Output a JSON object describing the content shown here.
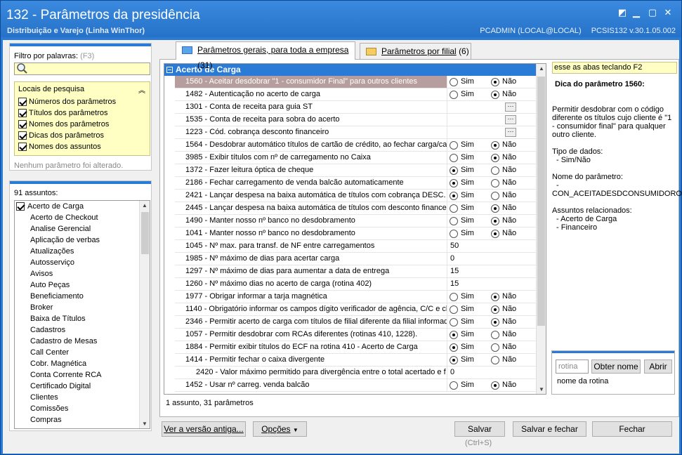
{
  "window": {
    "title": "132 - Parâmetros da presidência",
    "subtitle": "Distribuição e Varejo (Linha WinThor)",
    "user": "PCADMIN (LOCAL@LOCAL)",
    "version": "PCSIS132  v.30.1.05.002"
  },
  "filter": {
    "label": "Filtro por palavras:",
    "shortcut": "(F3)",
    "value": "",
    "locais_title": "Locais de pesquisa",
    "options": [
      "Números dos parâmetros",
      "Títulos dos parâmetros",
      "Nomes dos parâmetros",
      "Dicas dos parâmetros",
      "Nomes dos assuntos"
    ],
    "status": "Nenhum parâmetro foi alterado."
  },
  "subjects": {
    "count_label": "91 assuntos:",
    "items": [
      "Acerto de Carga",
      "Acerto de Checkout",
      "Analise Gerencial",
      "Aplicação de verbas",
      "Atualizações",
      "Autosserviço",
      "Avisos",
      "Auto Peças",
      "Beneficiamento",
      "Broker",
      "Baixa de Títulos",
      "Cadastros",
      "Cadastro de Mesas",
      "Call Center",
      "Cobr. Magnética",
      "Conta Corrente RCA",
      "Certificado Digital",
      "Clientes",
      "Comissões",
      "Compras"
    ]
  },
  "tabs": [
    {
      "label": "Parâmetros gerais, para toda a empresa",
      "count": "(31)"
    },
    {
      "label": "Parâmetros por filial",
      "count": "(6)"
    }
  ],
  "grid": {
    "group": "Acerto de Carga",
    "sim": "Sim",
    "nao": "Não",
    "rows": [
      {
        "name": "1560 - Aceitar desdobrar \"1 - consumidor Final\" para outros clientes",
        "type": "radio",
        "value": "Não"
      },
      {
        "name": "1482 - Autenticação no acerto de carga",
        "type": "radio",
        "value": "Não"
      },
      {
        "name": "1301 - Conta de receita para guia ST",
        "type": "lookup",
        "value": ""
      },
      {
        "name": "1535 - Conta de receita para sobra do acerto",
        "type": "lookup",
        "value": ""
      },
      {
        "name": "1223 - Cód. cobrança desconto financeiro",
        "type": "lookup",
        "value": ""
      },
      {
        "name": "1564 - Desdobrar automático títulos de cartão de crédito, ao fechar carga/ca",
        "type": "radio",
        "value": "Não"
      },
      {
        "name": "3985 - Exibir títulos com nº de carregamento no Caixa",
        "type": "radio",
        "value": "Não"
      },
      {
        "name": "1372 - Fazer leitura óptica de cheque",
        "type": "radio",
        "value": "Sim"
      },
      {
        "name": "2186 - Fechar carregamento de venda balcão automaticamente",
        "type": "radio",
        "value": "Sim"
      },
      {
        "name": "2421 - Lançar despesa na baixa automática de títulos com cobrança DESC.",
        "type": "radio",
        "value": "Sim"
      },
      {
        "name": "2445 - Lançar despesa na baixa automática de títulos com desconto financeir",
        "type": "radio",
        "value": "Não"
      },
      {
        "name": "1490 - Manter nosso nº banco no desdobramento",
        "type": "radio",
        "value": "Não"
      },
      {
        "name": "1041 - Manter nosso nº banco no desdobramento",
        "type": "radio",
        "value": "Não"
      },
      {
        "name": "1045 - Nº max. para transf. de NF entre carregamentos",
        "type": "number",
        "value": "50"
      },
      {
        "name": "1985 - Nº máximo de dias para acertar carga",
        "type": "number",
        "value": "0"
      },
      {
        "name": "1297 - Nº máximo de dias para aumentar a data de entrega",
        "type": "number",
        "value": "15"
      },
      {
        "name": "1260 - Nº máximo dias no acerto de carga (rotina 402)",
        "type": "number",
        "value": "15"
      },
      {
        "name": "1977 - Obrigar informar a tarja magnética",
        "type": "radio",
        "value": "Não"
      },
      {
        "name": "1140 - Obrigatório informar os campos dígito verificador de agência, C/C e ch",
        "type": "radio",
        "value": "Não"
      },
      {
        "name": "2346 - Permitir acerto de carga com títulos de filial diferente da filial informad",
        "type": "radio",
        "value": "Não"
      },
      {
        "name": "1057 - Permitir desdobrar com RCAs diferentes (rotinas 410, 1228).",
        "type": "radio",
        "value": "Sim"
      },
      {
        "name": "1884 - Permitir exibir títulos do ECF na rotina 410 - Acerto de Carga",
        "type": "radio",
        "value": "Sim"
      },
      {
        "name": "1414 - Permitir fechar o caixa divergente",
        "type": "radio",
        "value": "Sim"
      },
      {
        "name": "2420 - Valor máximo permitido para divergência entre o total acertado e f",
        "type": "number",
        "value": "0",
        "indent": true
      },
      {
        "name": "1452 - Usar nº carreg. venda balcão",
        "type": "radio",
        "value": "Não"
      }
    ],
    "status": "1 assunto, 31 parâmetros"
  },
  "tip": {
    "hint": "esse as abas teclando F2",
    "title": "Dica do parâmetro 1560:",
    "description": "Permitir desdobrar com o código diferente os títulos cujo cliente é \"1 - consumidor final\" para qualquer outro cliente.",
    "data_type_label": "Tipo de dados:",
    "data_type": "- Sim/Não",
    "param_name_label": "Nome do parâmetro:",
    "param_name_dash": "-",
    "param_name": "CON_ACEITADESDCONSUMIDORO",
    "related_label": "Assuntos relacionados:",
    "related": [
      "- Acerto de Carga",
      "- Financeiro"
    ]
  },
  "routine": {
    "placeholder": "rotina",
    "btn_nome": "Obter nome",
    "btn_abrir": "Abrir",
    "label": "nome da rotina"
  },
  "buttons": {
    "versao": "Ver a versão antiga...",
    "opcoes": "Opções",
    "salvar": "Salvar",
    "salvar_hint": "(Ctrl+S)",
    "salvar_fechar": "Salvar e fechar",
    "fechar": "Fechar"
  }
}
